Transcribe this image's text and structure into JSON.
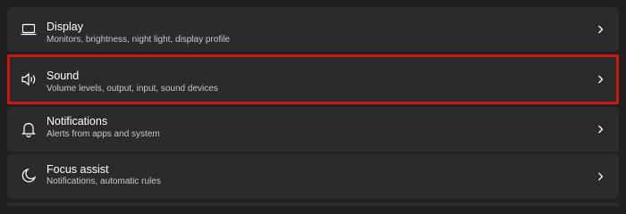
{
  "settings_list": {
    "items": [
      {
        "icon": "laptop-icon",
        "title": "Display",
        "description": "Monitors, brightness, night light, display profile"
      },
      {
        "icon": "speaker-icon",
        "title": "Sound",
        "description": "Volume levels, output, input, sound devices",
        "highlighted": true,
        "highlight_color": "#d01414"
      },
      {
        "icon": "bell-icon",
        "title": "Notifications",
        "description": "Alerts from apps and system"
      },
      {
        "icon": "moon-icon",
        "title": "Focus assist",
        "description": "Notifications, automatic rules"
      }
    ],
    "chevron_icon": "chevron-right-icon"
  },
  "colors": {
    "background": "#202020",
    "card": "#2b2b2b",
    "text": "#ffffff",
    "subtext": "#c8c8c8"
  }
}
